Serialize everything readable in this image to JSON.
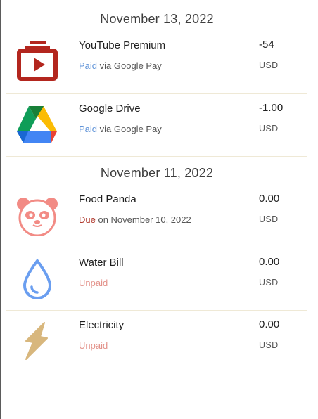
{
  "groups": [
    {
      "date": "November 13, 2022",
      "items": [
        {
          "title": "YouTube Premium",
          "status": "Paid",
          "detail": " via Google Pay",
          "amount": "-54",
          "currency": "USD",
          "icon": "youtube-icon"
        },
        {
          "title": "Google Drive",
          "status": "Paid",
          "detail": " via Google Pay",
          "amount": "-1.00",
          "currency": "USD",
          "icon": "google-drive-icon"
        }
      ]
    },
    {
      "date": "November 11, 2022",
      "items": [
        {
          "title": "Food Panda",
          "status": "Due",
          "detail": " on November 10, 2022",
          "amount": "0.00",
          "currency": "USD",
          "icon": "food-panda-icon"
        },
        {
          "title": "Water Bill",
          "status": "Unpaid",
          "detail": "",
          "amount": "0.00",
          "currency": "USD",
          "icon": "water-drop-icon"
        },
        {
          "title": "Electricity",
          "status": "Unpaid",
          "detail": "",
          "amount": "0.00",
          "currency": "USD",
          "icon": "lightning-icon"
        }
      ]
    }
  ],
  "colors": {
    "paid": "#5f93d8",
    "due": "#b03a2e",
    "unpaid": "#e3928a",
    "divider": "#efe9d6"
  }
}
